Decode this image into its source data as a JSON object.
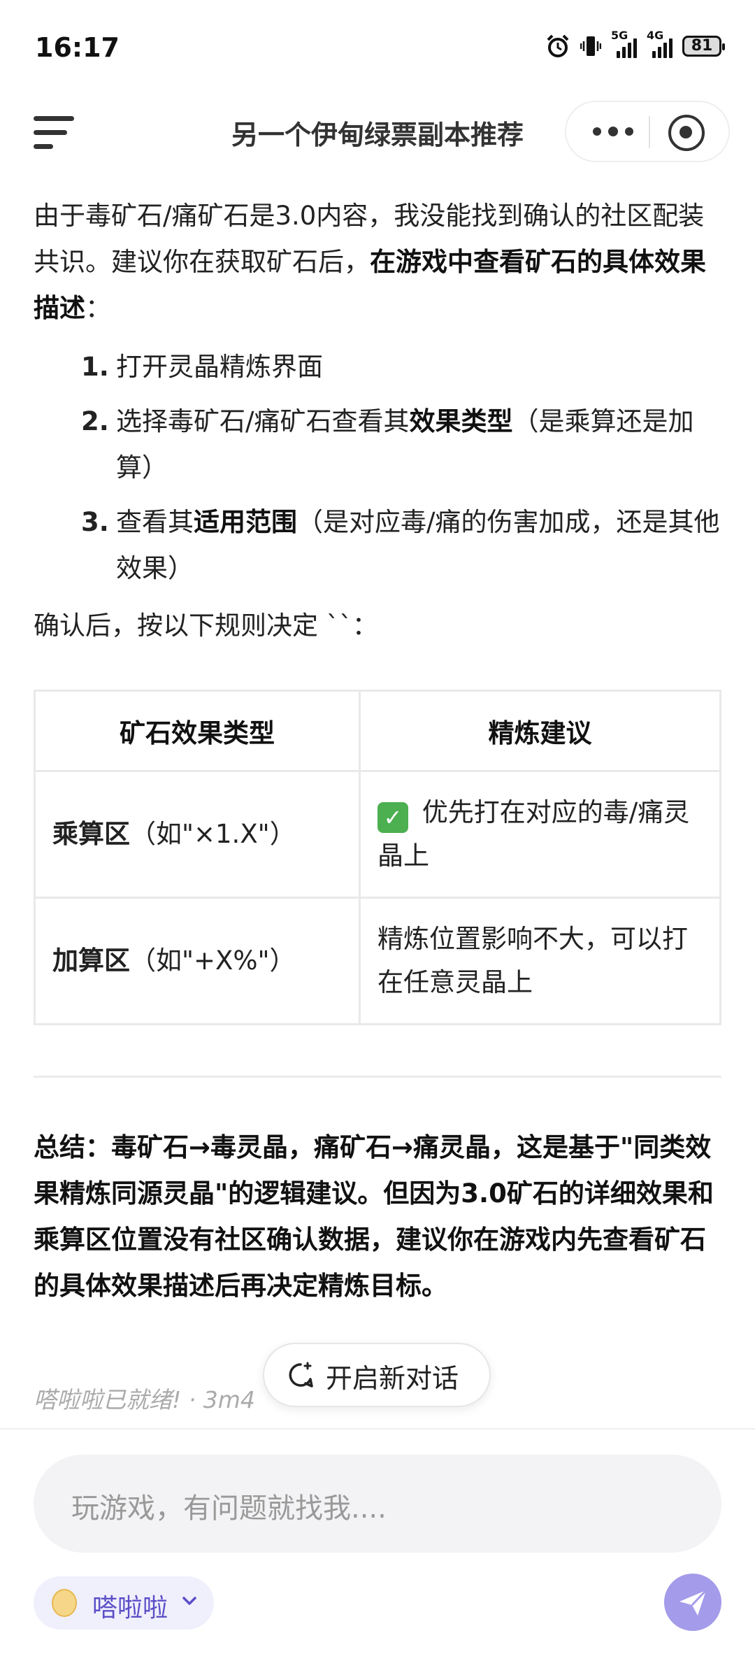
{
  "status_bar": {
    "time": "16:17",
    "battery": "81",
    "net1": "5G",
    "net2": "4G"
  },
  "header": {
    "title": "另一个伊甸绿票副本推荐"
  },
  "content": {
    "intro_1": "由于毒矿石/痛矿石是3.0内容，我没能找到确认的社区配装共识。建议你在获取矿石后，",
    "intro_bold": "在游戏中查看矿石的具体效果描述",
    "intro_2": "：",
    "steps": [
      {
        "num": "1.",
        "pre": "打开灵晶精炼界面",
        "bold": "",
        "post": ""
      },
      {
        "num": "2.",
        "pre": "选择毒矿石/痛矿石查看其",
        "bold": "效果类型",
        "post": "（是乘算还是加算）"
      },
      {
        "num": "3.",
        "pre": "查看其",
        "bold": "适用范围",
        "post": "（是对应毒/痛的伤害加成，还是其他效果）"
      }
    ],
    "confirm": "确认后，按以下规则决定 ``："
  },
  "table": {
    "headers": [
      "矿石效果类型",
      "精炼建议"
    ],
    "rows": [
      {
        "type_bold": "乘算区",
        "type_rest": "（如\"×1.X\"）",
        "advice_icon": "✅",
        "advice": " 优先打在对应的毒/痛灵晶上"
      },
      {
        "type_bold": "加算区",
        "type_rest": "（如\"+X%\"）",
        "advice_icon": "",
        "advice": "精炼位置影响不大，可以打在任意灵晶上"
      }
    ]
  },
  "summary": "总结：毒矿石→毒灵晶，痛矿石→痛灵晶，这是基于\"同类效果精炼同源灵晶\"的逻辑建议。但因为3.0矿石的详细效果和乘算区位置没有社区确认数据，建议你在游戏内先查看矿石的具体效果描述后再决定精炼目标。",
  "meta": "嗒啦啦已就绪! · 3m4",
  "new_chat": {
    "label": "开启新对话"
  },
  "input": {
    "placeholder": "玩游戏，有问题就找我...."
  },
  "bot": {
    "name": "嗒啦啦"
  },
  "colors": {
    "accent": "#a49bea",
    "bot_label": "#5b4fc7",
    "check": "#4caf50"
  }
}
